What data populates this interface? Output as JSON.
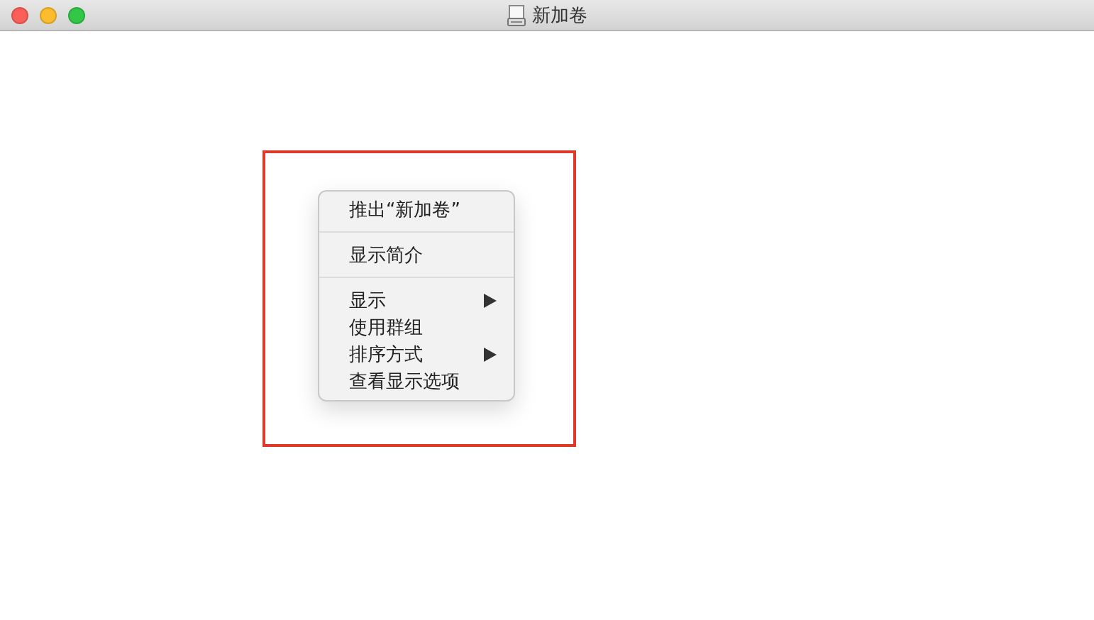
{
  "window": {
    "title": "新加卷"
  },
  "highlight": {
    "on": true
  },
  "menu": [
    {
      "kind": "item",
      "label": "推出“新加卷”",
      "submenu": false
    },
    {
      "kind": "separator"
    },
    {
      "kind": "item",
      "label": "显示简介",
      "submenu": false
    },
    {
      "kind": "separator"
    },
    {
      "kind": "item",
      "label": "显示",
      "submenu": true
    },
    {
      "kind": "item",
      "label": "使用群组",
      "submenu": false
    },
    {
      "kind": "item",
      "label": "排序方式",
      "submenu": true
    },
    {
      "kind": "item",
      "label": "查看显示选项",
      "submenu": false
    }
  ]
}
